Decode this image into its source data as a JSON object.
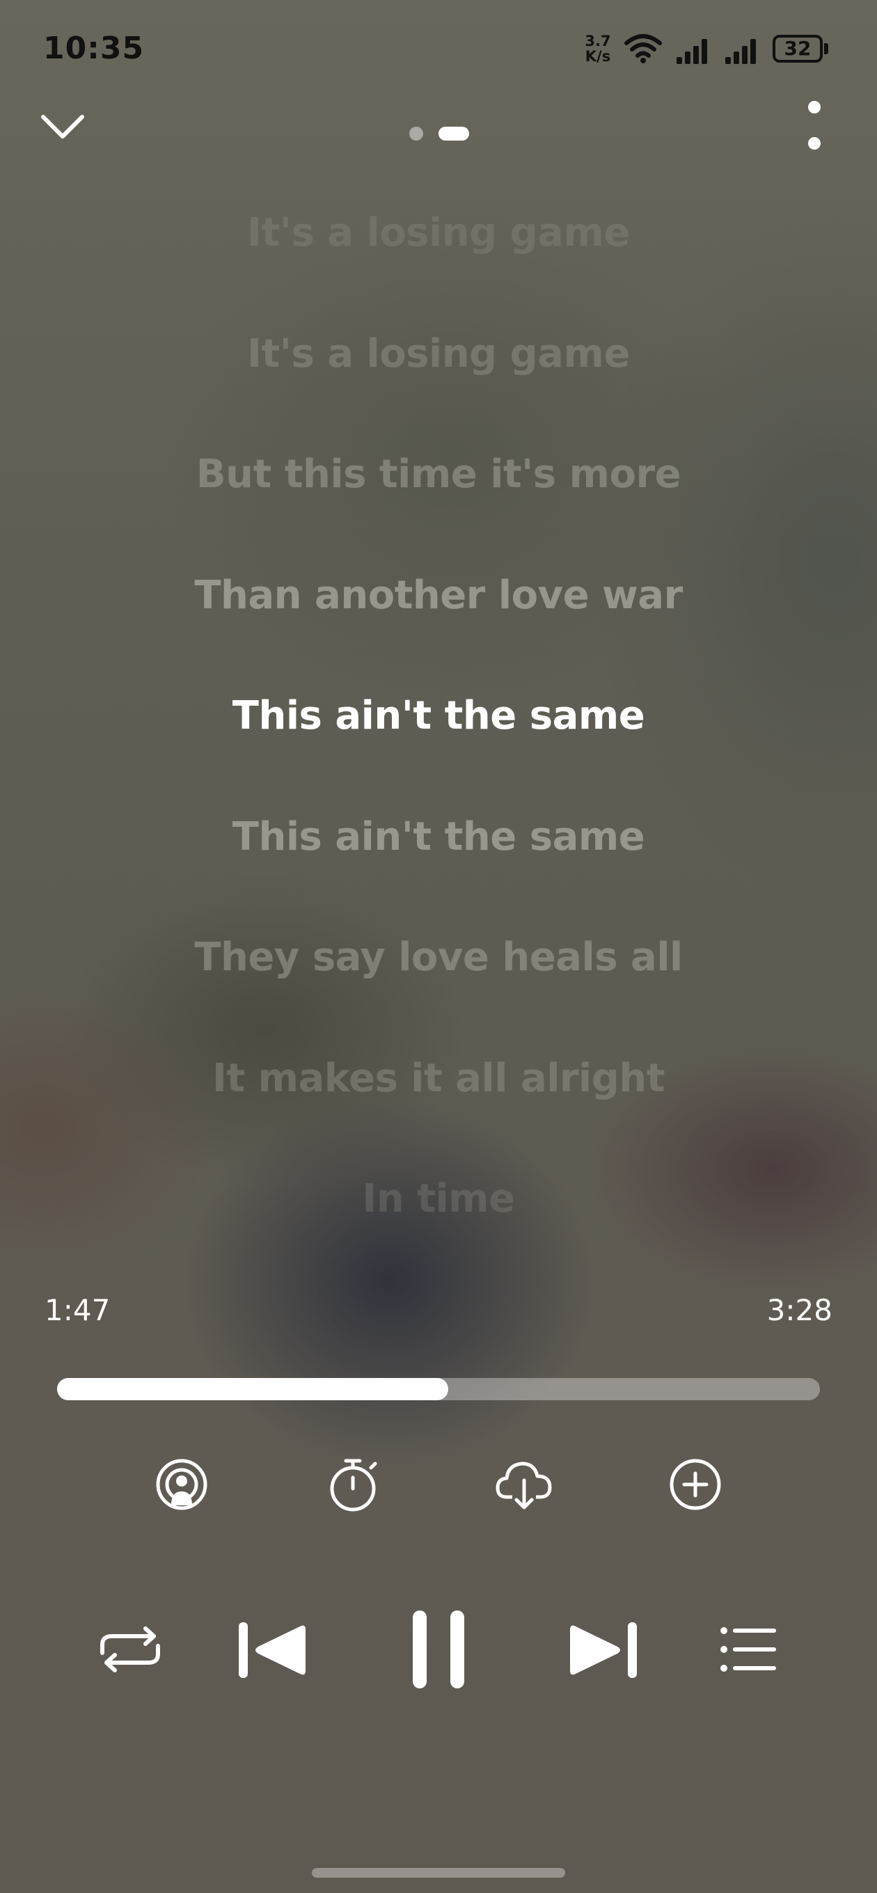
{
  "status_bar": {
    "time": "10:35",
    "net_speed_value": "3.7",
    "net_speed_unit": "K/s",
    "battery": "32",
    "icons": [
      "wifi-icon",
      "signal-icon",
      "signal-icon",
      "battery-icon"
    ]
  },
  "top_bar": {
    "icons": [
      "chevron-down-icon",
      "more-vertical-icon"
    ],
    "page_indicator": {
      "count": 2,
      "active_index": 1
    }
  },
  "lyrics": {
    "active_index": 4,
    "lines": [
      "It's a losing game",
      "It's a losing game",
      "But this time it's more",
      "Than another love war",
      "This ain't the same",
      "This ain't the same",
      "They say love heals all",
      "It makes it all alright",
      "In time"
    ]
  },
  "playback": {
    "elapsed": "1:47",
    "duration": "3:28",
    "progress_fraction": 0.513
  },
  "action_icons": [
    "broadcast-icon",
    "sleep-timer-icon",
    "cloud-download-icon",
    "add-circle-icon"
  ],
  "controls": {
    "icons": [
      "repeat-icon",
      "previous-icon",
      "pause-icon",
      "next-icon",
      "playlist-icon"
    ],
    "state": "playing"
  },
  "colors": {
    "text_active": "#ffffff",
    "status_text": "#111111"
  }
}
